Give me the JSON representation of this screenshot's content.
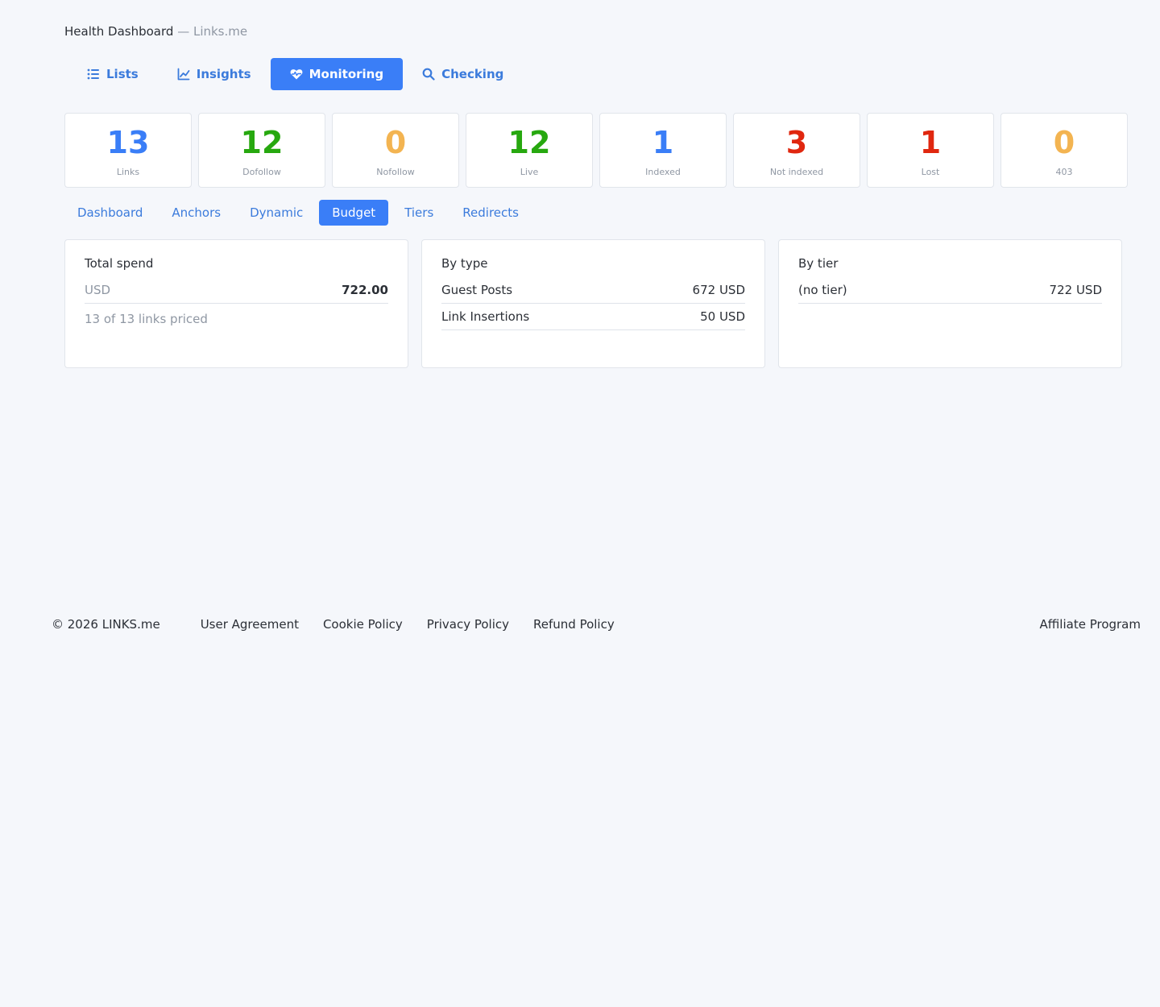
{
  "header": {
    "title": "Health Dashboard",
    "subtitle": "— Links.me"
  },
  "main_nav": [
    {
      "label": "Lists",
      "icon": "list-icon",
      "active": false
    },
    {
      "label": "Insights",
      "icon": "line-chart-icon",
      "active": false
    },
    {
      "label": "Monitoring",
      "icon": "heart-pulse-icon",
      "active": true
    },
    {
      "label": "Checking",
      "icon": "search-icon",
      "active": false
    }
  ],
  "stats": [
    {
      "value": "13",
      "label": "Links",
      "color": "#3a7ef7"
    },
    {
      "value": "12",
      "label": "Dofollow",
      "color": "#27a80f"
    },
    {
      "value": "0",
      "label": "Nofollow",
      "color": "#f3b451"
    },
    {
      "value": "12",
      "label": "Live",
      "color": "#27a80f"
    },
    {
      "value": "1",
      "label": "Indexed",
      "color": "#3a7ef7"
    },
    {
      "value": "3",
      "label": "Not indexed",
      "color": "#e0270f"
    },
    {
      "value": "1",
      "label": "Lost",
      "color": "#e0270f"
    },
    {
      "value": "0",
      "label": "403",
      "color": "#f3b451"
    }
  ],
  "sub_tabs": [
    {
      "label": "Dashboard",
      "active": false
    },
    {
      "label": "Anchors",
      "active": false
    },
    {
      "label": "Dynamic",
      "active": false
    },
    {
      "label": "Budget",
      "active": true
    },
    {
      "label": "Tiers",
      "active": false
    },
    {
      "label": "Redirects",
      "active": false
    }
  ],
  "cards": {
    "total": {
      "title": "Total spend",
      "currency": "USD",
      "amount": "722.00",
      "note": "13 of 13 links priced"
    },
    "by_type": {
      "title": "By type",
      "rows": [
        {
          "label": "Guest Posts",
          "value": "672 USD"
        },
        {
          "label": "Link Insertions",
          "value": "50 USD"
        }
      ]
    },
    "by_tier": {
      "title": "By tier",
      "rows": [
        {
          "label": "(no tier)",
          "value": "722 USD"
        }
      ]
    }
  },
  "footer": {
    "copyright": "© 2026 LINKS.me",
    "links": [
      "User Agreement",
      "Cookie Policy",
      "Privacy Policy",
      "Refund Policy"
    ],
    "affiliate": "Affiliate Program"
  }
}
